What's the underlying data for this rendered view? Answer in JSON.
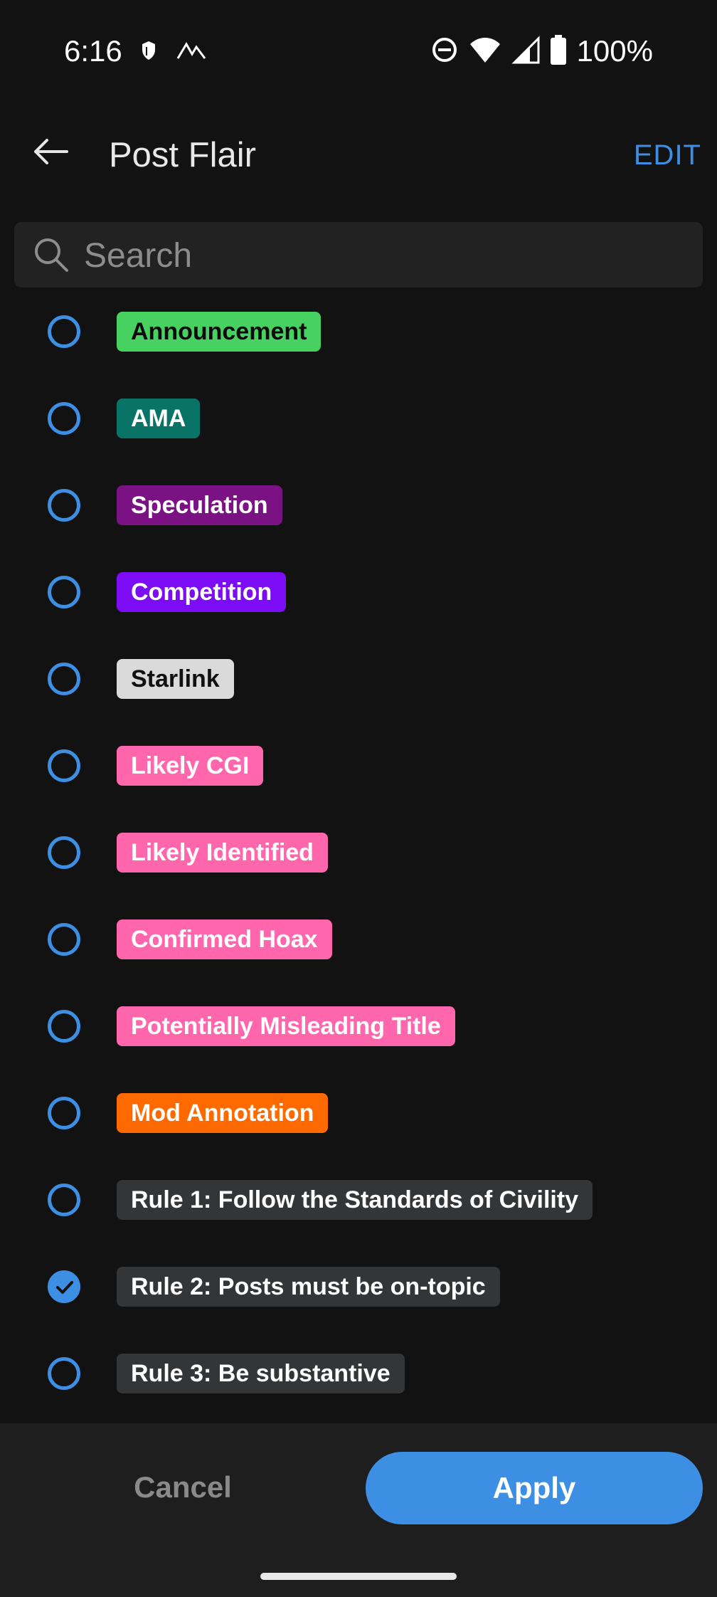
{
  "status_bar": {
    "time": "6:16",
    "battery_text": "100%"
  },
  "header": {
    "title": "Post Flair",
    "edit_label": "EDIT"
  },
  "search": {
    "placeholder": "Search",
    "value": ""
  },
  "flairs": [
    {
      "label": "Announcement",
      "bg": "#46d160",
      "fg": "#0b0b0b",
      "checked": false
    },
    {
      "label": "AMA",
      "bg": "#0a7368",
      "fg": "#ffffff",
      "checked": false
    },
    {
      "label": "Speculation",
      "bg": "#7a1284",
      "fg": "#ffffff",
      "checked": false
    },
    {
      "label": "Competition",
      "bg": "#7b0cf4",
      "fg": "#ffffff",
      "checked": false
    },
    {
      "label": "Starlink",
      "bg": "#dadada",
      "fg": "#111111",
      "checked": false
    },
    {
      "label": "Likely CGI",
      "bg": "#ff66ac",
      "fg": "#ffffff",
      "checked": false
    },
    {
      "label": "Likely Identified",
      "bg": "#ff66ac",
      "fg": "#ffffff",
      "checked": false
    },
    {
      "label": "Confirmed Hoax",
      "bg": "#ff66ac",
      "fg": "#ffffff",
      "checked": false
    },
    {
      "label": "Potentially Misleading Title",
      "bg": "#ff66ac",
      "fg": "#ffffff",
      "checked": false
    },
    {
      "label": "Mod Annotation",
      "bg": "#ff6a00",
      "fg": "#ffffff",
      "checked": false
    },
    {
      "label": "Rule 1: Follow the Standards of Civility",
      "bg": "#343536",
      "fg": "#ffffff",
      "checked": false
    },
    {
      "label": "Rule 2: Posts must be on-topic",
      "bg": "#343536",
      "fg": "#ffffff",
      "checked": true
    },
    {
      "label": "Rule 3: Be substantive",
      "bg": "#343536",
      "fg": "#ffffff",
      "checked": false
    }
  ],
  "footer": {
    "cancel_label": "Cancel",
    "apply_label": "Apply"
  },
  "colors": {
    "accent": "#3d8fe3",
    "background": "#121212"
  }
}
